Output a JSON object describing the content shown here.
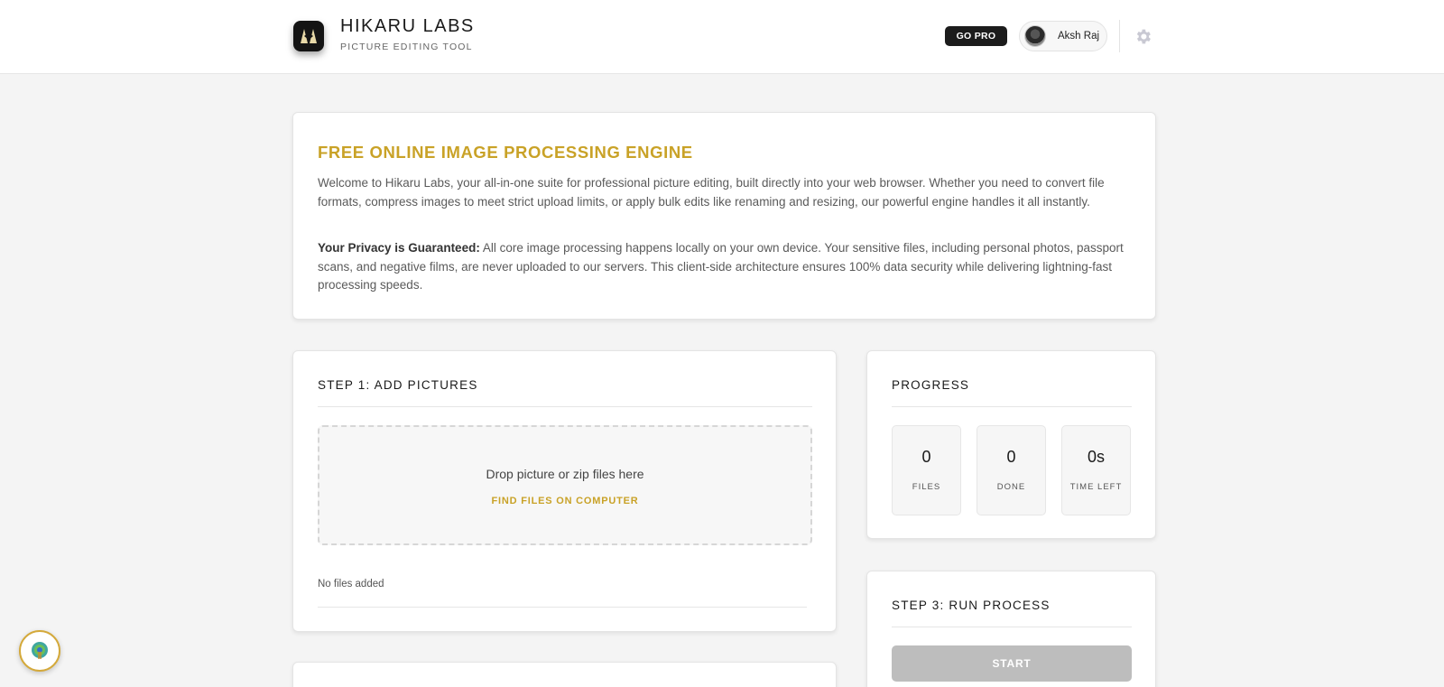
{
  "header": {
    "brand_title": "HIKARU LABS",
    "brand_subtitle": "PICTURE EDITING TOOL",
    "go_pro_label": "GO PRO",
    "user_name": "Aksh Raj"
  },
  "intro": {
    "title": "FREE ONLINE IMAGE PROCESSING ENGINE",
    "paragraph1": "Welcome to Hikaru Labs, your all-in-one suite for professional picture editing, built directly into your web browser. Whether you need to convert file formats, compress images to meet strict upload limits, or apply bulk edits like renaming and resizing, our powerful engine handles it all instantly.",
    "privacy_heading": "Your Privacy is Guaranteed:",
    "privacy_text": " All core image processing happens locally on your own device. Your sensitive files, including personal photos, passport scans, and negative films, are never uploaded to our servers. This client-side architecture ensures 100% data security while delivering lightning-fast processing speeds."
  },
  "step1": {
    "title": "STEP 1: ADD PICTURES",
    "drop_text": "Drop picture or zip files here",
    "find_files_label": "FIND FILES ON COMPUTER",
    "file_status": "No files added"
  },
  "progress": {
    "title": "PROGRESS",
    "stats": [
      {
        "value": "0",
        "label": "FILES"
      },
      {
        "value": "0",
        "label": "DONE"
      },
      {
        "value": "0s",
        "label": "TIME LEFT"
      }
    ]
  },
  "step3": {
    "title": "STEP 3: RUN PROCESS",
    "start_label": "START"
  },
  "colors": {
    "accent": "#c9a227",
    "background": "#f4f4f4",
    "disabled_button": "#bdbdbd"
  },
  "icons": {
    "logo": "hikaru-logo-icon",
    "settings": "gear-icon",
    "assistant": "peacock-icon"
  }
}
